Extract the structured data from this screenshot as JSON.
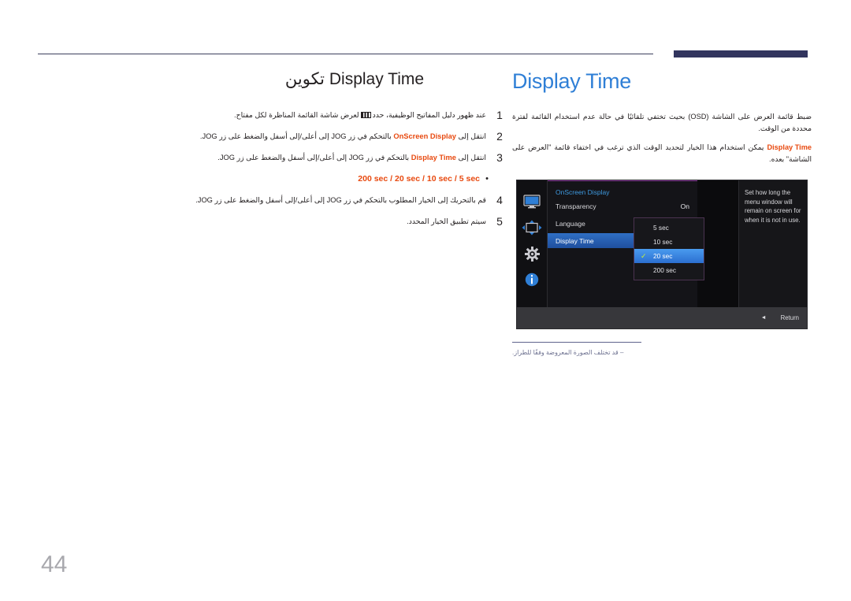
{
  "page": {
    "number": "44"
  },
  "left": {
    "title_ar": "تكوين",
    "title_en": "Display Time",
    "steps": [
      {
        "num": "1",
        "before_icon": "عند ظهور دليل المفاتيح الوظيفية، حدد",
        "icon": "keyguide-icon",
        "after_icon": "لعرض شاشة القائمة المناظرة لكل مفتاح."
      },
      {
        "num": "2",
        "pre": "انتقل إلى",
        "highlight": "OnScreen Display",
        "post": "بالتحكم في زر",
        "jog": "JOG",
        "tail": "إلى أعلى/إلى أسفل والضغط على زر",
        "jog2": "JOG",
        "end": "."
      },
      {
        "num": "3",
        "pre": "انتقل إلى",
        "highlight": "Display Time",
        "post": "بالتحكم في زر",
        "jog": "JOG",
        "tail": "إلى أعلى/إلى أسفل والضغط على زر",
        "jog2": "JOG",
        "end": "."
      },
      {
        "num": "4",
        "pre": "قم بالتحريك إلى الخيار المطلوب بالتحكم في زر",
        "jog": "JOG",
        "tail": "إلى أعلى/إلى أسفل والضغط على زر",
        "jog2": "JOG",
        "end": "."
      },
      {
        "num": "5",
        "pre": "سيتم تطبيق الخيار المحدد.",
        "jog": "",
        "tail": "",
        "jog2": "",
        "end": ""
      }
    ],
    "bullet": {
      "dot": "•",
      "options": "200 sec / 20 sec / 10 sec / 5 sec"
    }
  },
  "right": {
    "title": "Display Time",
    "paragraph1": "ضبط قائمة العرض على الشاشة (OSD) بحيث تختفي تلقائيًا في حالة عدم استخدام القائمة لفترة محددة من الوقت.",
    "paragraph2_highlight": "Display Time",
    "paragraph2": "يمكن استخدام هذا الخيار لتحديد الوقت الذي ترغب في اختفاء قائمة \"العرض على الشاشة\" بعده.",
    "note": "قد تختلف الصورة المعروضة وفقًا للطراز.",
    "note_dash": "‒"
  },
  "osd": {
    "sidebar_icons": [
      "monitor-icon",
      "move-arrows-icon",
      "gear-icon",
      "info-icon"
    ],
    "panel_title": "OnScreen Display",
    "rows": [
      {
        "label": "Transparency",
        "value": "On",
        "selected": false
      },
      {
        "label": "Language",
        "value": "",
        "selected": false
      },
      {
        "label": "Display Time",
        "value": "",
        "selected": true
      }
    ],
    "dropdown": {
      "items": [
        {
          "label": "5 sec",
          "selected": false
        },
        {
          "label": "10 sec",
          "selected": false
        },
        {
          "label": "20 sec",
          "selected": true
        },
        {
          "label": "200 sec",
          "selected": false
        }
      ],
      "check_glyph": "✓"
    },
    "description": "Set how long the menu window will remain on screen for when it is not in use.",
    "footer": {
      "arrow": "◄",
      "label": "Return"
    },
    "colors": {
      "accent_blue": "#2f7fd6",
      "highlight_orange": "#e8490f",
      "selection_blue": "#2b6fd0",
      "check_green": "#c8f23a",
      "panel_border": "#8d3b9e"
    }
  }
}
